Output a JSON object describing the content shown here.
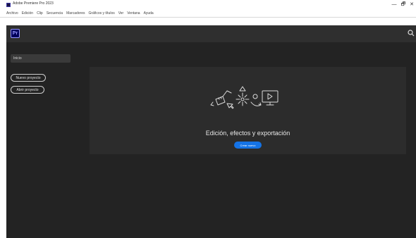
{
  "window": {
    "title": "Adobe Premiere Pro 2023",
    "controls": {
      "minimize": "—",
      "maximize": "🗗",
      "close": "✕"
    }
  },
  "menu": {
    "items": [
      "Archivo",
      "Edición",
      "Clip",
      "Secuencia",
      "Marcadores",
      "Gráficos y títulos",
      "Ver",
      "Ventana",
      "Ayuda"
    ]
  },
  "header": {
    "logo": "Pr",
    "icons": {
      "search": "search-icon"
    }
  },
  "sidebar": {
    "home_label": "Inicio",
    "new_project": "Nuevo proyecto",
    "open_project": "Abrir proyecto"
  },
  "main": {
    "heading": "Edición, efectos y exportación",
    "cta": "Crear nuevo"
  },
  "colors": {
    "accent": "#1473e6",
    "logo_bg": "#00005b",
    "logo_fg": "#9999ff",
    "app_bg": "#232323",
    "panel_bg": "#2c2c2c"
  }
}
